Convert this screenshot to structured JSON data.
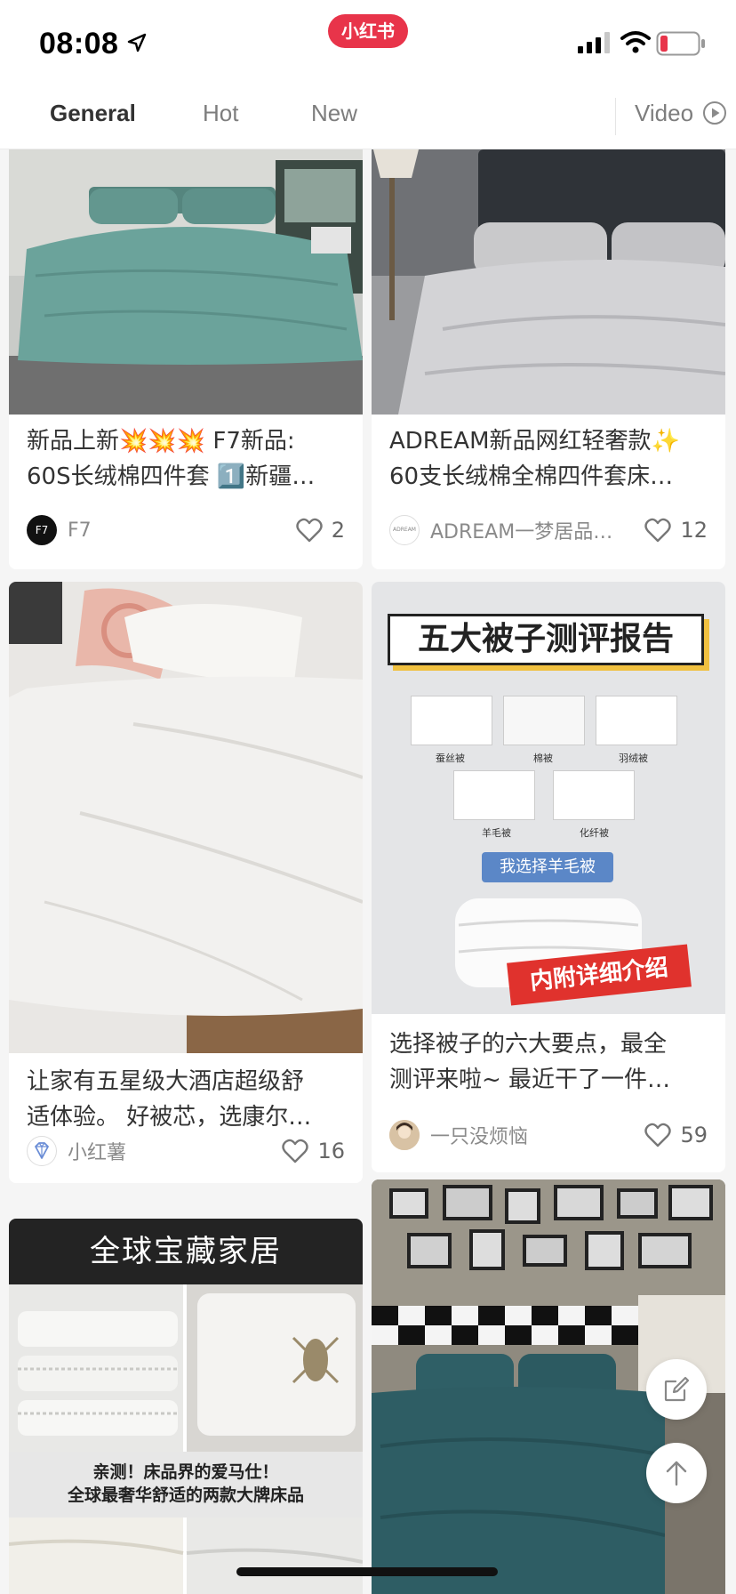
{
  "status_bar": {
    "time": "08:08",
    "app_logo": "小红书"
  },
  "tabs": [
    {
      "label": "General",
      "active": true
    },
    {
      "label": "Hot",
      "active": false
    },
    {
      "label": "New",
      "active": false
    }
  ],
  "video_tab": {
    "label": "Video",
    "icon": "play-circle-icon"
  },
  "cards": [
    {
      "title_line1": "新品上新💥💥💥 F7新品:",
      "title_line2": "60S长绒棉四件套 1️⃣新疆…",
      "author": "F7",
      "likes": "2"
    },
    {
      "title_line1": "ADREAM新品网红轻奢款✨",
      "title_line2": "60支长绒棉全棉四件套床…",
      "author": "ADREAM一梦居品…",
      "likes": "12"
    },
    {
      "title_line1": "让家有五星级大酒店超级舒",
      "title_line2": "适体验。 好被芯，选康尔…",
      "author": "小红薯",
      "likes": "16"
    },
    {
      "title_line1": "选择被子的六大要点，最全",
      "title_line2": "测评来啦~ 最近干了一件…",
      "author": "一只没烦恼",
      "likes": "59"
    },
    {
      "banner": "全球宝藏家居",
      "caption_line1": "亲测！床品界的爱马仕！",
      "caption_line2": "全球最奢华舒适的两款大牌床品"
    }
  ],
  "quilt_report": {
    "title": "五大被子测评报告",
    "items": [
      "蚕丝被",
      "棉被",
      "羽绒被",
      "羊毛被",
      "化纤被"
    ],
    "choice": "我选择羊毛被",
    "stamp": "内附详细介绍"
  },
  "avatars": {
    "f7_avatar": "F7",
    "adream_avatar": "ADREAM"
  },
  "colors": {
    "brand_red": "#e8344a",
    "page_bg": "#f5f5f5",
    "battery_low": "#e8344a"
  }
}
